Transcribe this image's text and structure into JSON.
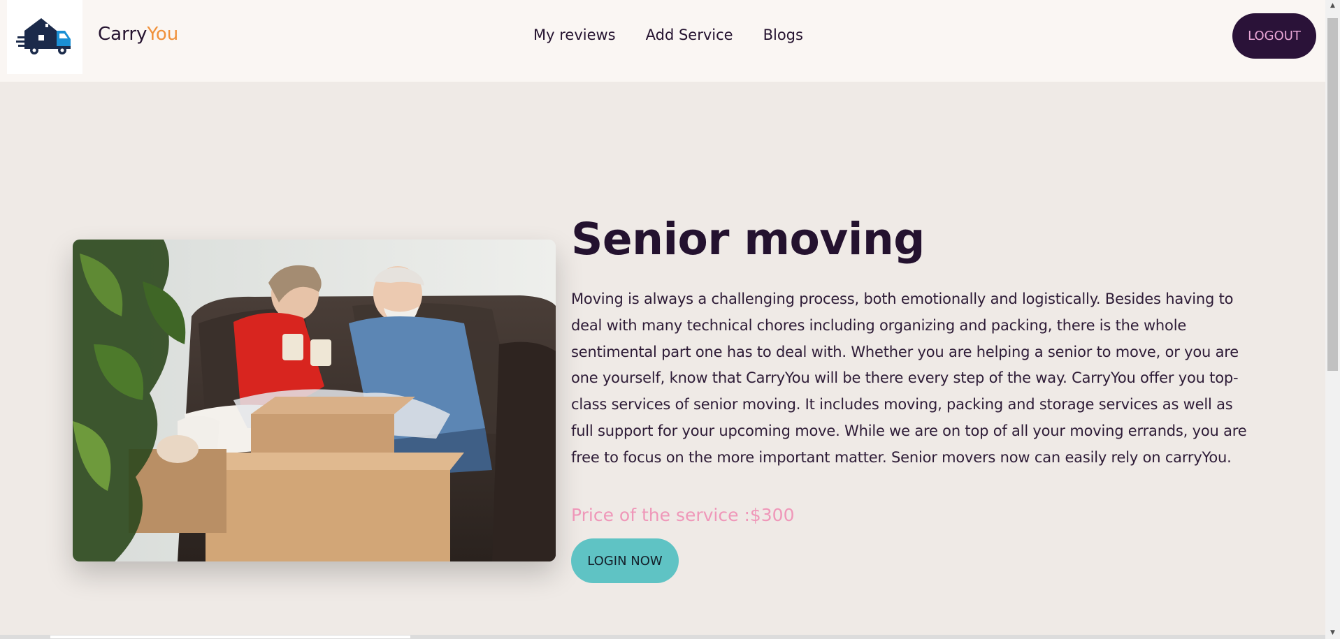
{
  "header": {
    "brand_primary": "Carry",
    "brand_accent": "You",
    "nav": [
      {
        "label": "My reviews"
      },
      {
        "label": "Add Service"
      },
      {
        "label": "Blogs"
      }
    ],
    "logout_label": "LOGOUT"
  },
  "service": {
    "title": "Senior moving",
    "description": "Moving is always a challenging process, both emotionally and logistically. Besides having to deal with many technical chores including organizing and packing, there is the whole sentimental part one has to deal with. Whether you are helping a senior to move, or you are one yourself, know that CarryYou will be there every step of the way. CarryYou offer you top-class services of senior moving. It includes moving, packing and storage services as well as full support for your upcoming move. While we are on top of all your moving errands, you are free to focus on the more important matter. Senior movers now can easily rely on carryYou.",
    "price_text": "Price of the service :$300",
    "login_label": "LOGIN NOW"
  },
  "colors": {
    "brand_dark": "#24122f",
    "brand_accent": "#f0913b",
    "price_pink": "#ef97b9",
    "login_teal": "#5fc3c4",
    "logout_bg": "#2a1238",
    "logout_text": "#e9a6d6"
  }
}
